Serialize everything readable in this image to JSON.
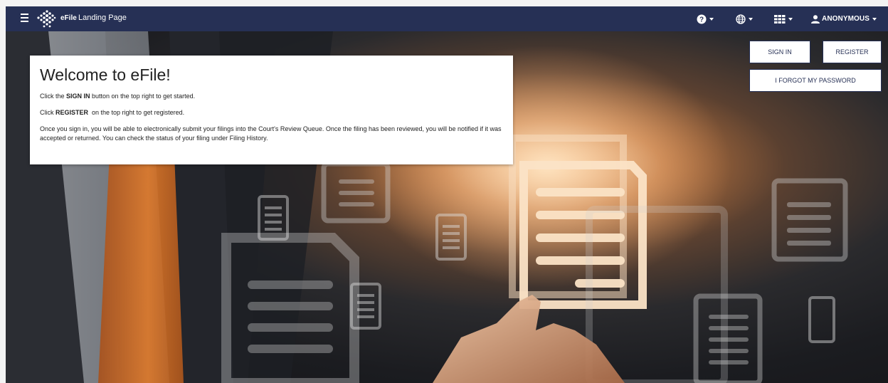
{
  "navbar": {
    "brand": "eFile",
    "page_title": "Landing Page",
    "icons": [
      "menu-icon",
      "efile-logo",
      "help-icon",
      "globe-icon",
      "apps-grid-icon",
      "user-icon"
    ],
    "user_label": "ANONYMOUS"
  },
  "welcome": {
    "title": "Welcome to eFile!",
    "line1_pre": "Click the ",
    "line1_bold": "SIGN IN",
    "line1_post": " button on the top right to get started.",
    "line2_pre": "Click ",
    "line2_bold": "REGISTER",
    "line2_post": "  on the top right to get registered.",
    "line3": "Once you sign in, you will be able to electronically submit your filings into the Court's Review Queue. Once the filing has been reviewed, you will be notified if it was accepted or returned. You can check the status of your filing under Filing History."
  },
  "auth": {
    "sign_in": "SIGN IN",
    "register": "REGISTER",
    "forgot_password": "I FORGOT MY PASSWORD"
  },
  "colors": {
    "navbar_bg": "#263055",
    "button_border": "#263055",
    "button_text": "#263055"
  }
}
